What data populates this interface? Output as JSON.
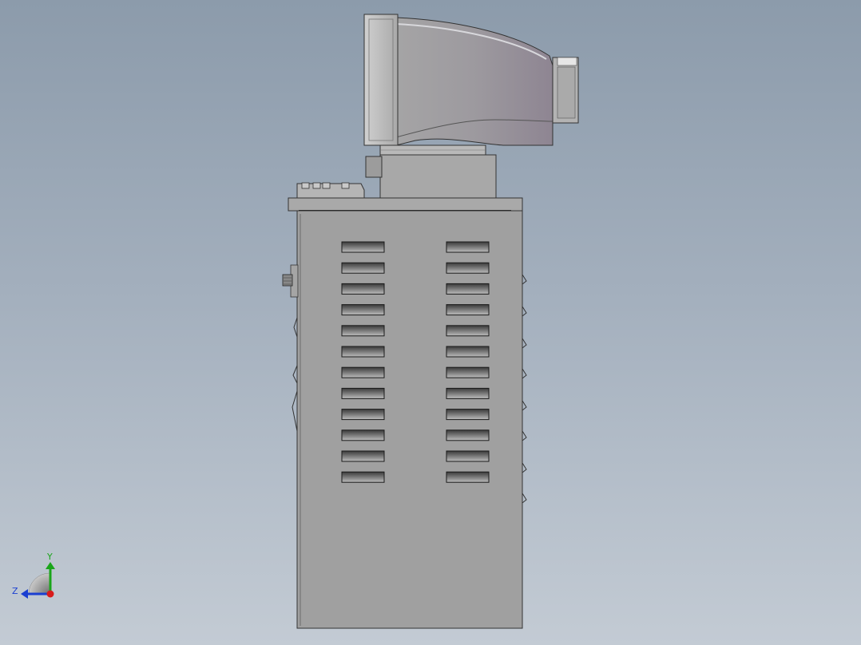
{
  "triad": {
    "y_label": "Y",
    "z_label": "Z",
    "y_color": "#1aa51a",
    "z_color": "#1b3fd1",
    "x_color": "#d81b1b"
  },
  "model": {
    "monitor_color": "#9c9a9e",
    "cabinet_color": "#9f9f9f",
    "vent_rows": 12,
    "vent_columns": 2
  }
}
